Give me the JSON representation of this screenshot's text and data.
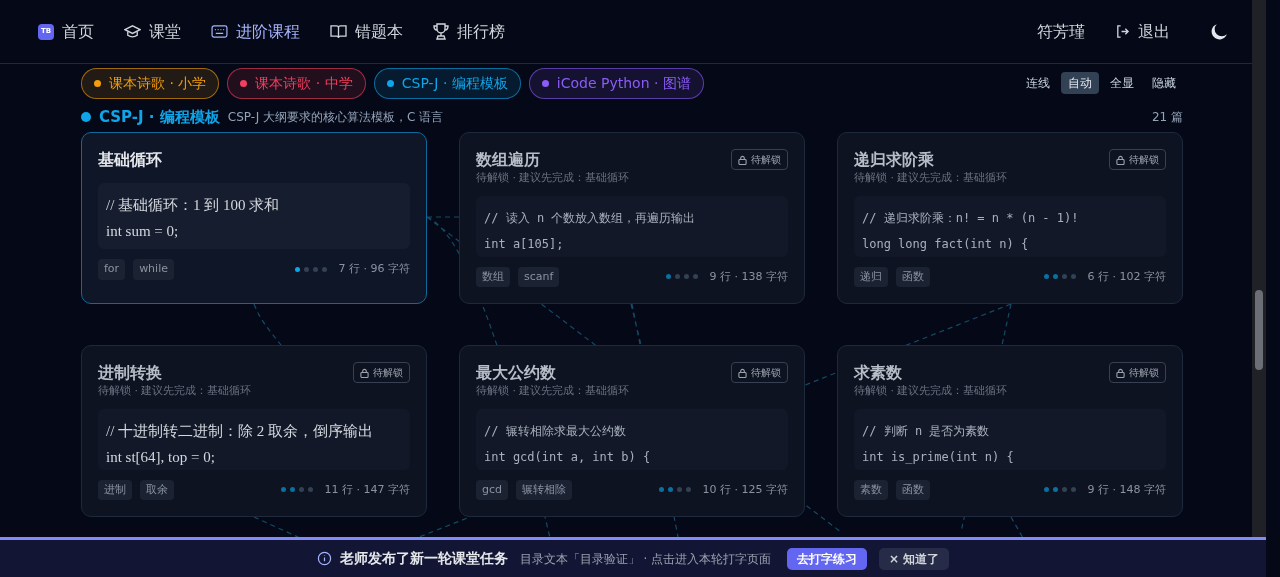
{
  "nav": {
    "logo": "TB",
    "items": [
      {
        "label": "首页",
        "selected": false
      },
      {
        "label": "课堂",
        "selected": false
      },
      {
        "label": "进阶课程",
        "selected": true
      },
      {
        "label": "错题本",
        "selected": false
      },
      {
        "label": "排行榜",
        "selected": false
      }
    ],
    "user": "符芳瑾",
    "logout": "退出"
  },
  "filters": [
    {
      "label": "课本诗歌 · 小学",
      "color": "#f59e0b"
    },
    {
      "label": "课本诗歌 · 中学",
      "color": "#f43f5e"
    },
    {
      "label": "CSP-J · 编程模板",
      "color": "#0ea5e9"
    },
    {
      "label": "iCode Python · 图谱",
      "color": "#8b5cf6"
    }
  ],
  "lines_toggle": {
    "label": "连线",
    "options": [
      {
        "label": "自动",
        "selected": true
      },
      {
        "label": "全显",
        "selected": false
      },
      {
        "label": "隐藏",
        "selected": false
      }
    ]
  },
  "section": {
    "title": "CSP-J · 编程模板",
    "subtitle": "CSP-J 大纲要求的核心算法模板，C 语言",
    "count": "21 篇"
  },
  "cards": [
    {
      "title": "基础循环",
      "locked": false,
      "kind": "serif",
      "code": [
        "// 基础循环：1 到 100 求和",
        "int sum = 0;"
      ],
      "tags": [
        "for",
        "while"
      ],
      "level": 0.25,
      "meta": "7 行 · 96 字符"
    },
    {
      "title": "数组遍历",
      "locked": true,
      "badge": "待解锁",
      "subtitle": "待解锁 · 建议先完成：基础循环",
      "kind": "mono",
      "code": [
        "// 读入 n 个数放入数组，再遍历输出",
        "int a[105];"
      ],
      "tags": [
        "数组",
        "scanf"
      ],
      "level": 0.25,
      "meta": "9 行 · 138 字符"
    },
    {
      "title": "递归求阶乘",
      "locked": true,
      "badge": "待解锁",
      "subtitle": "待解锁 · 建议先完成：基础循环",
      "kind": "mono",
      "code": [
        "// 递归求阶乘：n! = n * (n - 1)!",
        "long long fact(int n) {"
      ],
      "tags": [
        "递归",
        "函数"
      ],
      "level": 0.5,
      "meta": "6 行 · 102 字符"
    },
    {
      "title": "进制转换",
      "locked": true,
      "badge": "待解锁",
      "subtitle": "待解锁 · 建议先完成：基础循环",
      "kind": "serif",
      "code": [
        "// 十进制转二进制：除 2 取余，倒序输出",
        "int st[64], top = 0;"
      ],
      "tags": [
        "进制",
        "取余"
      ],
      "level": 0.5,
      "meta": "11 行 · 147 字符"
    },
    {
      "title": "最大公约数",
      "locked": true,
      "badge": "待解锁",
      "subtitle": "待解锁 · 建议先完成：基础循环",
      "kind": "mono",
      "code": [
        "// 辗转相除求最大公约数",
        "int gcd(int a, int b) {"
      ],
      "tags": [
        "gcd",
        "辗转相除"
      ],
      "level": 0.5,
      "meta": "10 行 · 125 字符"
    },
    {
      "title": "求素数",
      "locked": true,
      "badge": "待解锁",
      "subtitle": "待解锁 · 建议先完成：基础循环",
      "kind": "mono",
      "code": [
        "// 判断 n 是否为素数",
        "int is_prime(int n) {"
      ],
      "tags": [
        "素数",
        "函数"
      ],
      "level": 0.5,
      "meta": "9 行 · 148 字符"
    }
  ],
  "banner": {
    "title": "老师发布了新一轮课堂任务",
    "text": "目录文本「目录验证」 · 点击进入本轮打字页面",
    "primary": "去打字练习",
    "dismiss": "× 知道了"
  }
}
